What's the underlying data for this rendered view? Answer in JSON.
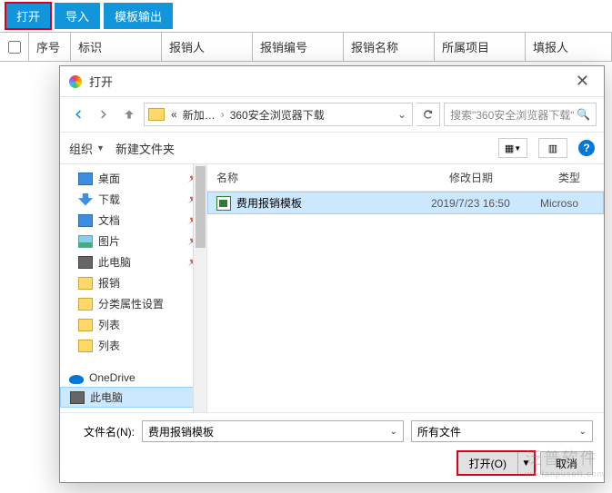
{
  "toolbar": {
    "open": "打开",
    "import": "导入",
    "template_out": "模板输出"
  },
  "grid": {
    "seq": "序号",
    "flag": "标识",
    "col_a": "报销人",
    "col_b": "报销编号",
    "col_c": "报销名称",
    "col_d": "所属项目",
    "col_e": "填报人"
  },
  "dialog": {
    "title": "打开",
    "breadcrumb": {
      "a": "«",
      "b": "新加…",
      "c": "360安全浏览器下载"
    },
    "search_placeholder": "搜索\"360安全浏览器下载\"",
    "organize": "组织",
    "new_folder": "新建文件夹",
    "tree": [
      {
        "label": "桌面",
        "icon": "desktop",
        "pin": true
      },
      {
        "label": "下载",
        "icon": "down",
        "pin": true
      },
      {
        "label": "文档",
        "icon": "doc",
        "pin": true
      },
      {
        "label": "图片",
        "icon": "pic",
        "pin": true
      },
      {
        "label": "此电脑",
        "icon": "pc",
        "pin": true
      },
      {
        "label": "报销",
        "icon": "folder"
      },
      {
        "label": "分类属性设置",
        "icon": "folder"
      },
      {
        "label": "列表",
        "icon": "folder"
      },
      {
        "label": "列表",
        "icon": "folder"
      }
    ],
    "tree2": [
      {
        "label": "OneDrive",
        "icon": "cloud",
        "l1": true
      },
      {
        "label": "此电脑",
        "icon": "pc",
        "l1": true,
        "selected": true
      }
    ],
    "cols": {
      "name": "名称",
      "date": "修改日期",
      "type": "类型"
    },
    "file": {
      "name": "费用报销模板",
      "date": "2019/7/23 16:50",
      "type": "Microso"
    },
    "fn_label": "文件名(N):",
    "fn_value": "费用报销模板",
    "filter": "所有文件",
    "open_btn": "打开(O)",
    "cancel_btn": "取消"
  },
  "watermark": {
    "big": "泛普软件",
    "small": "ww.fanpusoft.com"
  }
}
